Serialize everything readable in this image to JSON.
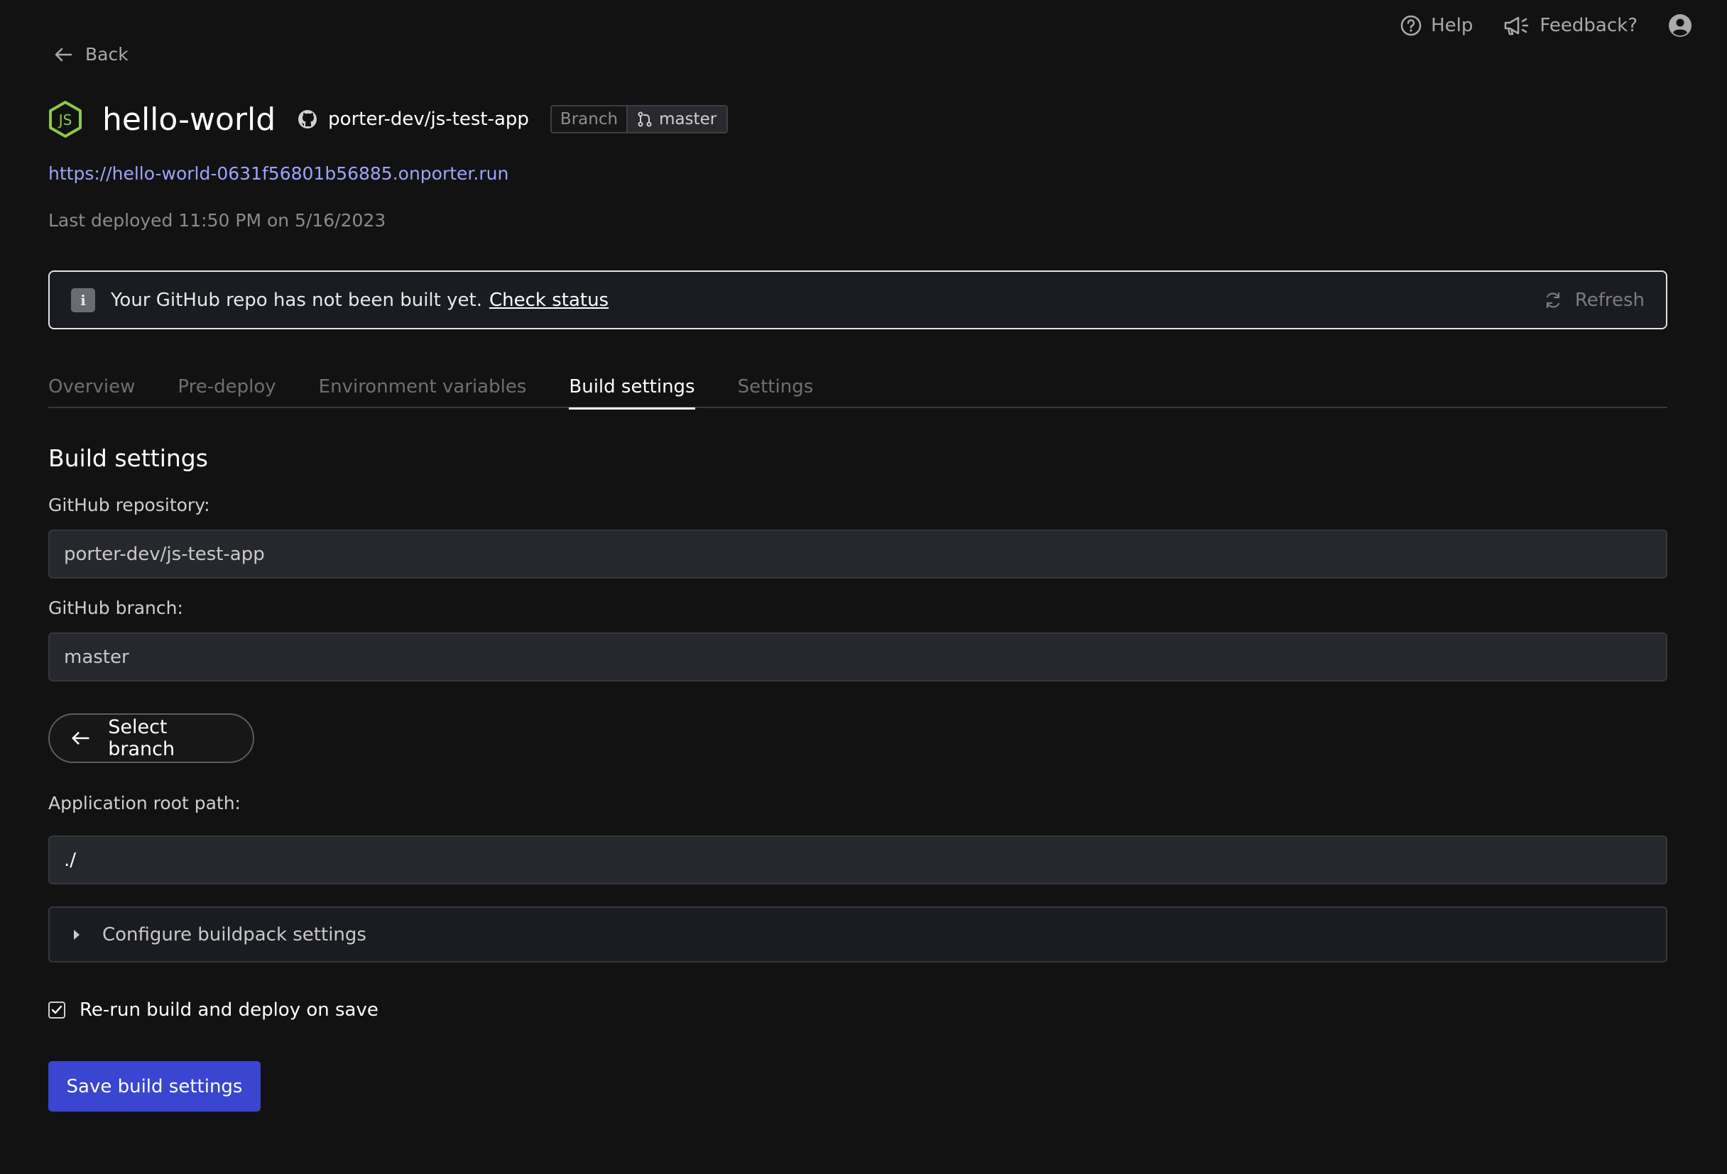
{
  "header": {
    "help_label": "Help",
    "feedback_label": "Feedback?"
  },
  "nav": {
    "back_label": "Back"
  },
  "app": {
    "name": "hello-world",
    "repo": "porter-dev/js-test-app",
    "branch_label": "Branch",
    "branch": "master",
    "url": "https://hello-world-0631f56801b56885.onporter.run",
    "last_deployed": "Last deployed 11:50 PM on 5/16/2023"
  },
  "banner": {
    "message": "Your GitHub repo has not been built yet.",
    "link_label": "Check status",
    "refresh_label": "Refresh"
  },
  "tabs": [
    {
      "label": "Overview",
      "active": false
    },
    {
      "label": "Pre-deploy",
      "active": false
    },
    {
      "label": "Environment variables",
      "active": false
    },
    {
      "label": "Build settings",
      "active": true
    },
    {
      "label": "Settings",
      "active": false
    }
  ],
  "build_settings": {
    "title": "Build settings",
    "repo_label": "GitHub repository:",
    "repo_value": "porter-dev/js-test-app",
    "branch_label": "GitHub branch:",
    "branch_value": "master",
    "select_branch_label": "Select branch",
    "root_path_label": "Application root path:",
    "root_path_value": "./",
    "buildpack_label": "Configure buildpack settings",
    "rerun_label": "Re-run build and deploy on save",
    "rerun_checked": true,
    "save_label": "Save build settings"
  },
  "colors": {
    "background": "#121212",
    "accent": "#3a45d0",
    "link": "#9ea3ff",
    "node_green": "#8cc84b"
  },
  "icons": [
    "help-icon",
    "megaphone-icon",
    "user-icon",
    "arrow-left-icon",
    "nodejs-icon",
    "github-icon",
    "git-branch-icon",
    "info-icon",
    "refresh-icon",
    "caret-right-icon",
    "check-icon"
  ]
}
